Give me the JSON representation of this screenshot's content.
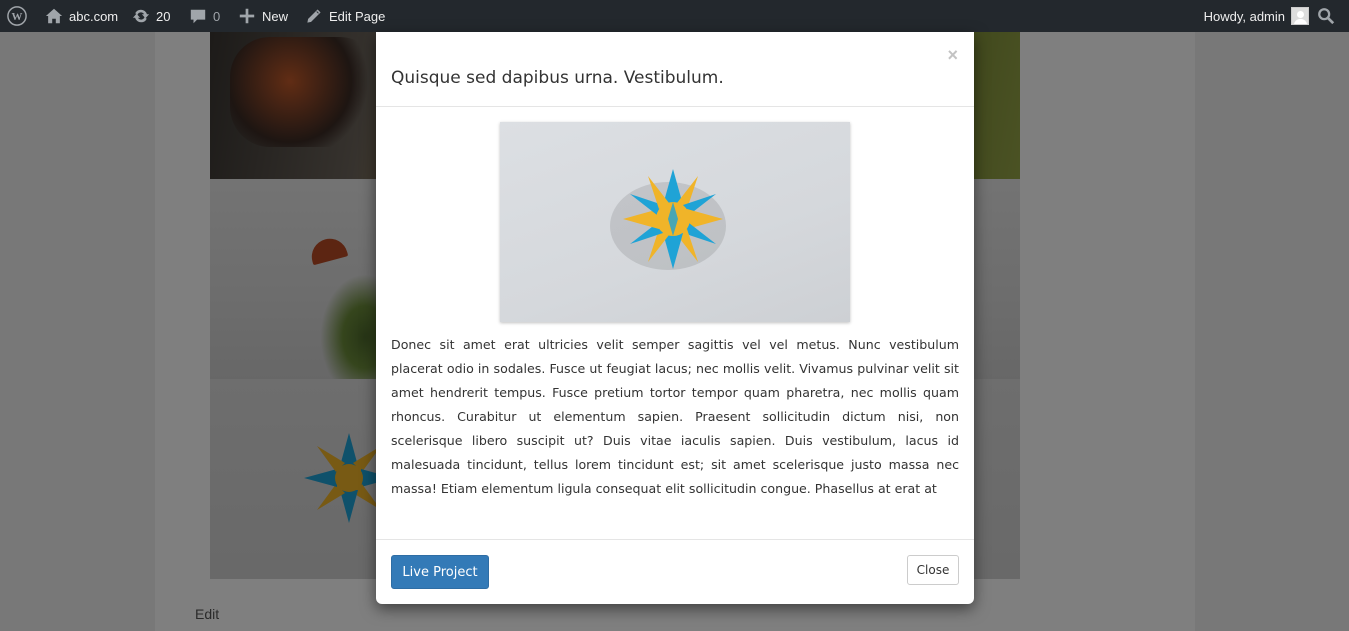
{
  "adminbar": {
    "site_name": "abc.com",
    "updates_count": "20",
    "comments_count": "0",
    "new_label": "New",
    "edit_page_label": "Edit Page",
    "howdy": "Howdy, admin"
  },
  "page": {
    "edit_link": "Edit"
  },
  "modal": {
    "close_x": "×",
    "title": "Quisque sed dapibus urna. Vestibulum.",
    "body_text": "Donec sit amet erat ultricies velit semper sagittis vel vel metus. Nunc vestibulum placerat odio in sodales. Fusce ut feugiat lacus; nec mollis velit. Vivamus pulvinar velit sit amet hendrerit tempus. Fusce pretium tortor tempor quam pharetra, nec mollis quam rhoncus. Curabitur ut elementum sapien. Praesent sollicitudin dictum nisi, non scelerisque libero suscipit ut? Duis vitae iaculis sapien. Duis vestibulum, lacus id malesuada tincidunt, tellus lorem tincidunt est; sit amet scelerisque justo massa nec massa! Etiam elementum ligula consequat elit sollicitudin congue. Phasellus at erat at",
    "live_button": "Live Project",
    "close_button": "Close"
  },
  "colors": {
    "adminbar_bg": "#23282d",
    "primary_button": "#337ab7",
    "star_yellow": "#f0b429",
    "star_blue": "#1fa3d6"
  },
  "icons": [
    "wordpress-icon",
    "home-icon",
    "updates-icon",
    "comment-icon",
    "plus-icon",
    "pencil-icon",
    "avatar",
    "search-icon"
  ]
}
